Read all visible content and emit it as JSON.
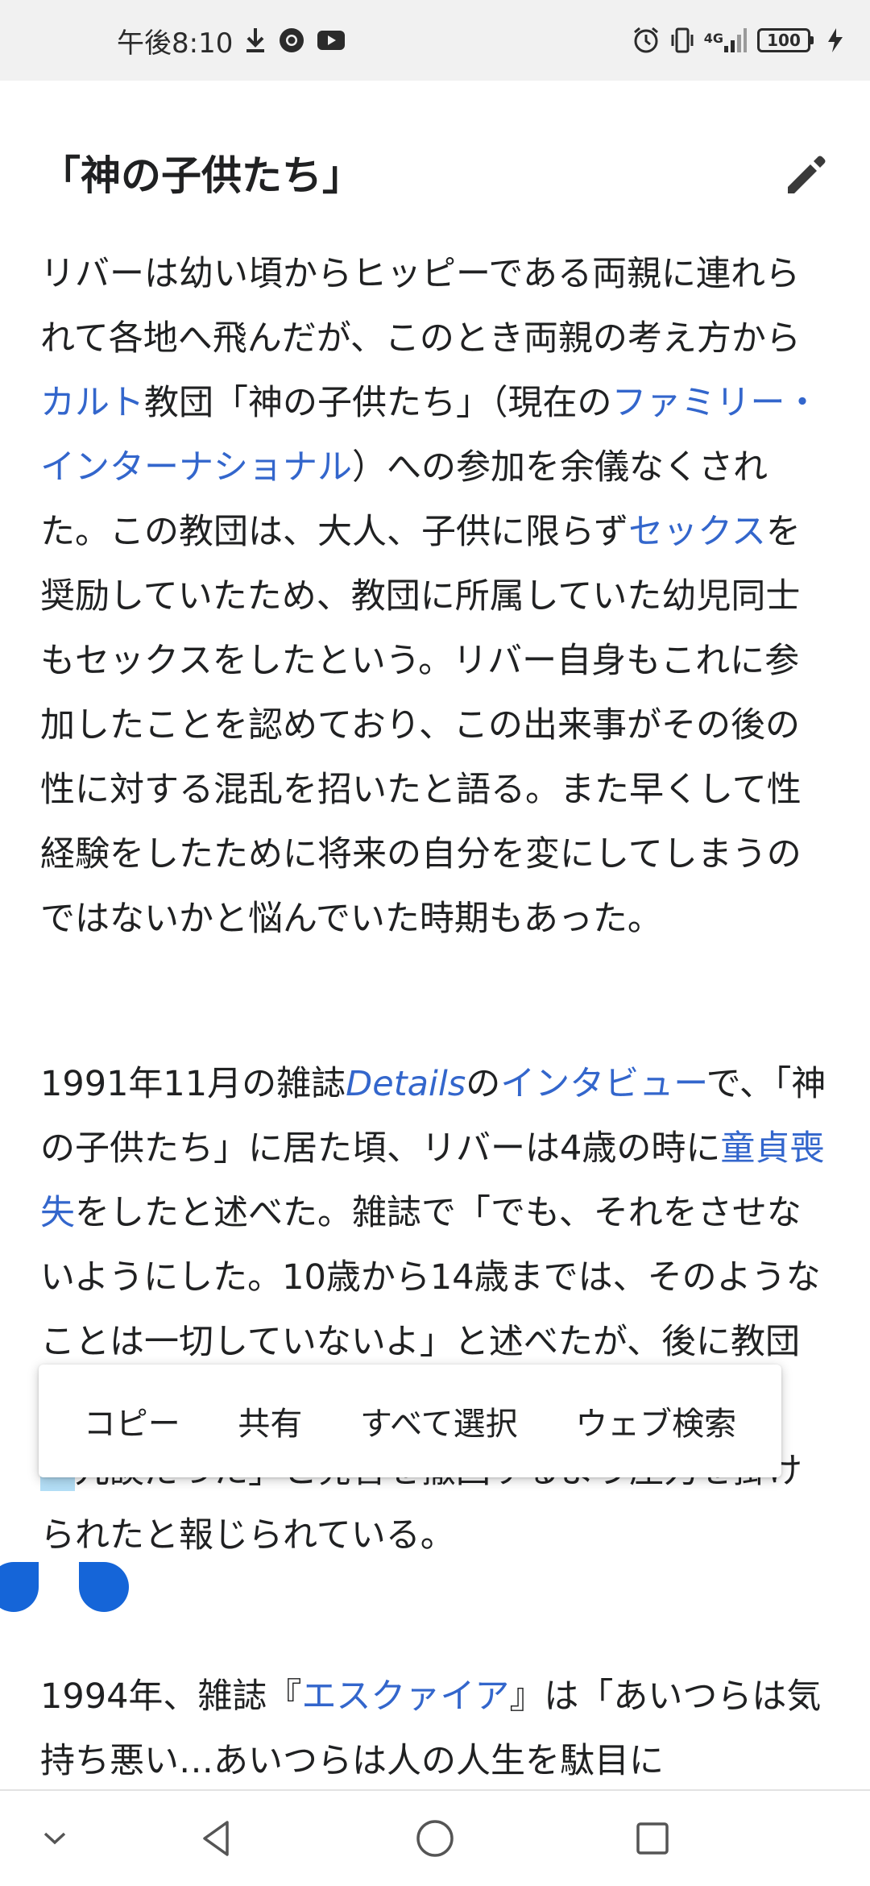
{
  "status_bar": {
    "time": "午後8:10",
    "icons": [
      "download-icon",
      "chrome-icon",
      "youtube-icon",
      "alarm-icon",
      "vibrate-icon",
      "signal-4g-icon",
      "battery-icon",
      "charging-icon"
    ],
    "network": "4G",
    "battery_level": "100"
  },
  "article": {
    "section_heading": "「神の子供たち」",
    "edit_icon": "pencil-icon",
    "paragraph1": {
      "t1": "リバーは幼い頃からヒッピーである両親に連れられて各地へ飛んだが、このとき両親の考え方から",
      "link1": "カルト",
      "t2": "教団「神の子供たち」（現在の",
      "link2": "ファミリー・インターナショナル",
      "t3": "）への参加を余儀なくされた。この教団は、大人、子供に限らず",
      "link3": "セックス",
      "t4": "を奨励していたため、教団に所属していた幼児同士もセックスをしたという。リバー自身もこれに参加したことを認めており、この出来事がその後の性に対する混乱を招いたと語る。また早くして性経験をしたために将来の自分を変にしてしまうのではないかと悩んでいた時期もあった。"
    },
    "paragraph2": {
      "t1": "1991年11月の雑誌",
      "link1": "Details",
      "t2": "の",
      "link2": "インタビュー",
      "t3": "で、「神の子供たち」に居た頃、リバーは4歳の時に",
      "link3": "童貞喪失",
      "t4": "をしたと述べた。雑誌で「でも、それをさせないようにした。10歳から14歳までは、そのようなことは一切していない",
      "t5": "よ」と述べたが、後に教団の指導者らから「冗",
      "selected": "「",
      "t6": "冗談だった」と発言を撤回するよう圧力を掛けられたと報じられている。"
    },
    "paragraph3": {
      "t1": "1994年、雑誌『",
      "link1": "エスクァイア",
      "t2": "』は「あいつらは気持ち悪い…あいつらは人の人生を駄目に"
    }
  },
  "context_menu": {
    "copy": "コピー",
    "share": "共有",
    "select_all": "すべて選択",
    "web_search": "ウェブ検索"
  },
  "nav_bar": {
    "icons": [
      "collapse-icon",
      "back-icon",
      "home-icon",
      "recents-icon"
    ]
  },
  "colors": {
    "link": "#3366cc",
    "selection": "#b3def6",
    "handle": "#1565d8",
    "status_bar_bg": "#f1f1f1"
  }
}
